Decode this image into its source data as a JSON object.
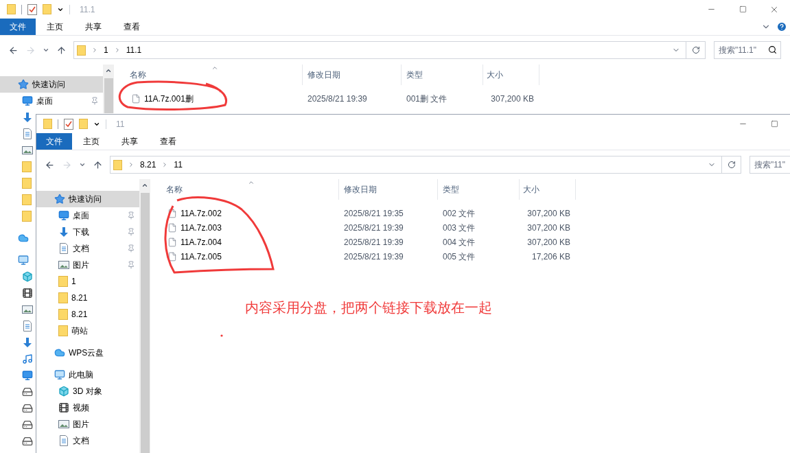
{
  "back_window": {
    "title": "11.1",
    "ribbon_tabs": [
      {
        "label": "文件",
        "selected": true
      },
      {
        "label": "主页",
        "selected": false
      },
      {
        "label": "共享",
        "selected": false
      },
      {
        "label": "查看",
        "selected": false
      }
    ],
    "path": [
      "1",
      "11.1"
    ],
    "search": {
      "placeholder": "搜索\"11.1\""
    },
    "nav": [
      {
        "kind": "quick",
        "label": "快速访问",
        "selected": true,
        "pinned": false
      },
      {
        "kind": "desktop",
        "label": "桌面",
        "selected": false,
        "pinned": true
      },
      {
        "kind": "download"
      },
      {
        "kind": "docs"
      },
      {
        "kind": "pictures"
      },
      {
        "kind": "folder"
      },
      {
        "kind": "folder"
      },
      {
        "kind": "folder"
      },
      {
        "kind": "folder"
      },
      {
        "kind": "cloud"
      },
      {
        "kind": "pc"
      },
      {
        "kind": "objects"
      },
      {
        "kind": "video"
      },
      {
        "kind": "pictures"
      },
      {
        "kind": "docs"
      },
      {
        "kind": "download"
      },
      {
        "kind": "music"
      },
      {
        "kind": "desktop"
      },
      {
        "kind": "drive"
      },
      {
        "kind": "drive"
      },
      {
        "kind": "drive"
      },
      {
        "kind": "drive"
      }
    ],
    "columns": [
      "名称",
      "修改日期",
      "类型",
      "大小"
    ],
    "files": [
      {
        "name": "11A.7z.001删",
        "modified": "2025/8/21 19:39",
        "type": "001删 文件",
        "size": "307,200 KB"
      }
    ]
  },
  "front_window": {
    "title": "11",
    "ribbon_tabs": [
      {
        "label": "文件",
        "selected": true
      },
      {
        "label": "主页",
        "selected": false
      },
      {
        "label": "共享",
        "selected": false
      },
      {
        "label": "查看",
        "selected": false
      }
    ],
    "path": [
      "8.21",
      "11"
    ],
    "search": {
      "placeholder": "搜索\"11\""
    },
    "nav": [
      {
        "kind": "quick",
        "label": "快速访问",
        "selected": true,
        "pinned": false
      },
      {
        "kind": "desktop",
        "label": "桌面",
        "selected": false,
        "pinned": true
      },
      {
        "kind": "download",
        "label": "下载",
        "selected": false,
        "pinned": true
      },
      {
        "kind": "docs",
        "label": "文档",
        "selected": false,
        "pinned": true
      },
      {
        "kind": "pictures",
        "label": "图片",
        "selected": false,
        "pinned": true
      },
      {
        "kind": "folder",
        "label": "1",
        "selected": false,
        "pinned": false
      },
      {
        "kind": "folder",
        "label": "8.21",
        "selected": false,
        "pinned": false
      },
      {
        "kind": "folder",
        "label": "8.21",
        "selected": false,
        "pinned": false
      },
      {
        "kind": "folder",
        "label": "萌站",
        "selected": false,
        "pinned": false
      },
      {
        "kind": "cloud",
        "label": "WPS云盘",
        "selected": false,
        "pinned": false
      },
      {
        "kind": "pc",
        "label": "此电脑",
        "selected": false,
        "pinned": false
      },
      {
        "kind": "objects",
        "label": "3D 对象",
        "selected": false,
        "pinned": false
      },
      {
        "kind": "video",
        "label": "视频",
        "selected": false,
        "pinned": false
      },
      {
        "kind": "pictures",
        "label": "图片",
        "selected": false,
        "pinned": false
      },
      {
        "kind": "docs",
        "label": "文档",
        "selected": false,
        "pinned": false
      }
    ],
    "columns": [
      "名称",
      "修改日期",
      "类型",
      "大小"
    ],
    "files": [
      {
        "name": "11A.7z.002",
        "modified": "2025/8/21 19:35",
        "type": "002 文件",
        "size": "307,200 KB"
      },
      {
        "name": "11A.7z.003",
        "modified": "2025/8/21 19:39",
        "type": "003 文件",
        "size": "307,200 KB"
      },
      {
        "name": "11A.7z.004",
        "modified": "2025/8/21 19:39",
        "type": "004 文件",
        "size": "307,200 KB"
      },
      {
        "name": "11A.7z.005",
        "modified": "2025/8/21 19:39",
        "type": "005 文件",
        "size": "17,206 KB"
      }
    ]
  },
  "annotations": {
    "note": "内容采用分盘，把两个链接下载放在一起"
  }
}
